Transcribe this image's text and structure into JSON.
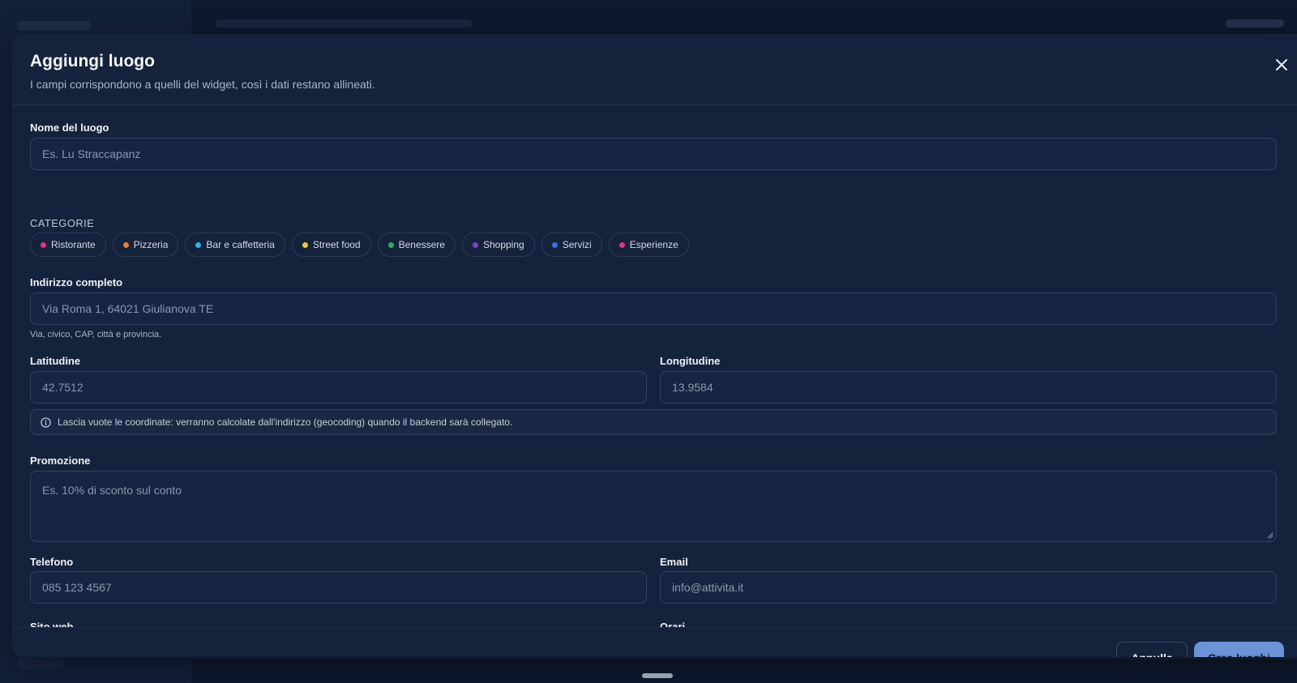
{
  "modal": {
    "title": "Aggiungi luogo",
    "subtitle": "I campi corrispondono a quelli del widget, così i dati restano allineati."
  },
  "form": {
    "name_label": "Nome del luogo",
    "name_placeholder": "Es. Lu Straccapanz",
    "categories_label": "CATEGORIE",
    "categories": [
      {
        "label": "Ristorante",
        "color": "#e0338a"
      },
      {
        "label": "Pizzeria",
        "color": "#f07a2a"
      },
      {
        "label": "Bar e caffetteria",
        "color": "#2fb4e6"
      },
      {
        "label": "Street food",
        "color": "#f2c43b"
      },
      {
        "label": "Benessere",
        "color": "#26b35a"
      },
      {
        "label": "Shopping",
        "color": "#7b3fc4"
      },
      {
        "label": "Servizi",
        "color": "#3b6fe0"
      },
      {
        "label": "Esperienze",
        "color": "#e0338a"
      }
    ],
    "address_label": "Indirizzo completo",
    "address_placeholder": "Via Roma 1, 64021 Giulianova TE",
    "address_hint": "Via, civico, CAP, città e provincia.",
    "lat_label": "Latitudine",
    "lat_placeholder": "42.7512",
    "lng_label": "Longitudine",
    "lng_placeholder": "13.9584",
    "info_text": "Lascia vuote le coordinate: verranno calcolate dall'indirizzo (geocoding) quando il backend sarà collegato.",
    "promo_label": "Promozione",
    "promo_placeholder": "Es. 10% di sconto sul conto",
    "phone_label": "Telefono",
    "phone_placeholder": "085 123 4567",
    "email_label": "Email",
    "email_placeholder": "info@attivita.it",
    "website_label": "Sito web",
    "hours_label": "Orari"
  },
  "footer": {
    "cancel_label": "Annulla",
    "create_label": "Crea luoghi"
  },
  "icons": {
    "close": "close-icon",
    "info": "info-icon"
  }
}
